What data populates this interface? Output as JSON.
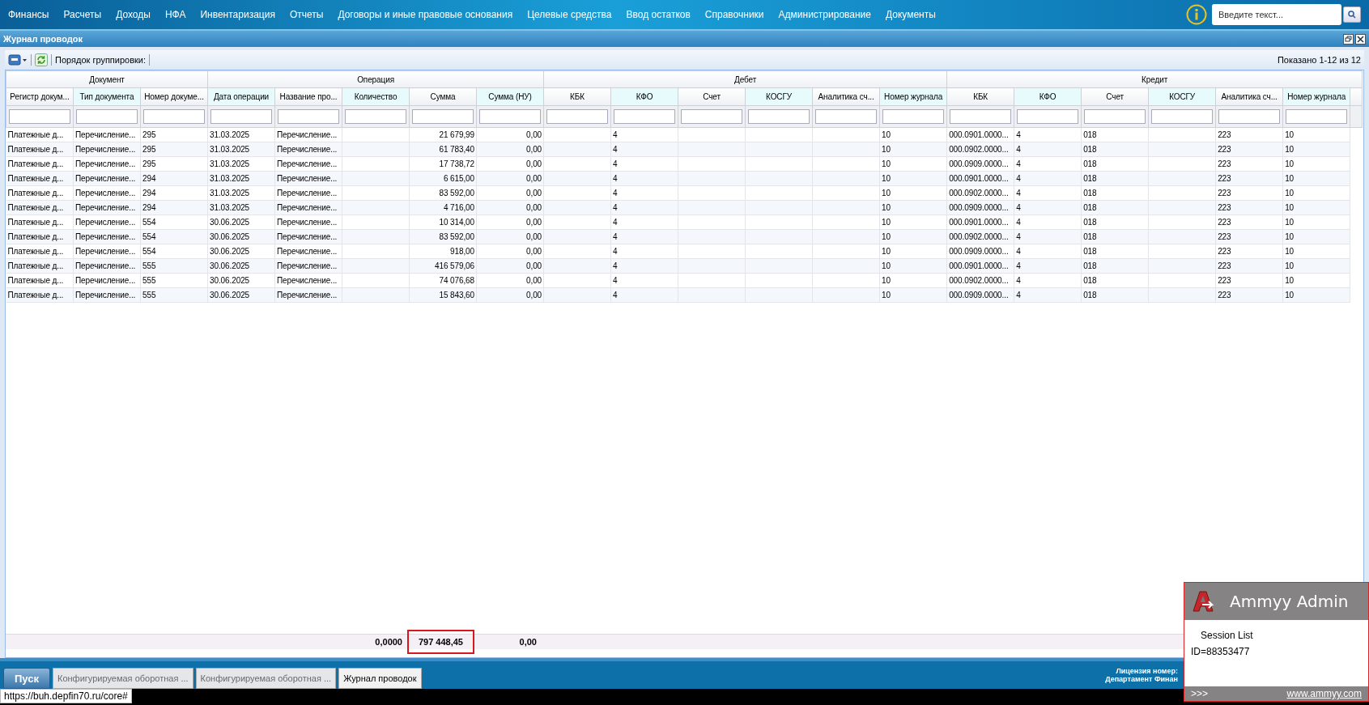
{
  "nav": {
    "items": [
      "Финансы",
      "Расчеты",
      "Доходы",
      "НФА",
      "Инвентаризация",
      "Отчеты",
      "Договоры и иные правовые основания",
      "Целевые средства",
      "Ввод остатков",
      "Справочники",
      "Администрирование",
      "Документы"
    ],
    "search": {
      "placeholder": "Введите текст..."
    }
  },
  "window": {
    "title": "Журнал проводок"
  },
  "toolbar": {
    "grouping_label": "Порядок группировки:",
    "paging": "Показано 1-12 из 12"
  },
  "table": {
    "groups": [
      {
        "title": "Документ",
        "columns": [
          {
            "title": "Регистр докум...",
            "kind": "text"
          },
          {
            "title": "Тип документа",
            "kind": "text"
          },
          {
            "title": "Номер докуме...",
            "kind": "text"
          }
        ]
      },
      {
        "title": "Операция",
        "columns": [
          {
            "title": "Дата операции",
            "kind": "text"
          },
          {
            "title": "Название про...",
            "kind": "text"
          },
          {
            "title": "Количество",
            "kind": "amount",
            "total": {
              "text": "0,0000",
              "highlighted": false
            }
          },
          {
            "title": "Сумма",
            "kind": "amount",
            "total": {
              "text": "797 448,45",
              "highlighted": true
            }
          },
          {
            "title": "Сумма (НУ)",
            "kind": "amount",
            "total": {
              "text": "0,00",
              "highlighted": false
            }
          }
        ]
      },
      {
        "title": "Дебет",
        "columns": [
          {
            "title": "КБК",
            "kind": "text"
          },
          {
            "title": "КФО",
            "kind": "text"
          },
          {
            "title": "Счет",
            "kind": "text"
          },
          {
            "title": "КОСГУ",
            "kind": "text"
          },
          {
            "title": "Аналитика сч...",
            "kind": "text"
          },
          {
            "title": "Номер журнала",
            "kind": "text"
          }
        ]
      },
      {
        "title": "Кредит",
        "columns": [
          {
            "title": "КБК",
            "kind": "text"
          },
          {
            "title": "КФО",
            "kind": "text"
          },
          {
            "title": "Счет",
            "kind": "text"
          },
          {
            "title": "КОСГУ",
            "kind": "text"
          },
          {
            "title": "Аналитика сч...",
            "kind": "text"
          },
          {
            "title": "Номер журнала",
            "kind": "text"
          }
        ]
      }
    ],
    "rows": [
      [
        "Платежные д...",
        "Перечисление...",
        "295",
        "31.03.2025",
        "Перечисление...",
        null,
        "21 679,99",
        "0,00",
        null,
        "4",
        null,
        null,
        null,
        "10",
        "000.0901.0000...",
        "4",
        "018",
        null,
        "223",
        "10"
      ],
      [
        "Платежные д...",
        "Перечисление...",
        "295",
        "31.03.2025",
        "Перечисление...",
        null,
        "61 783,40",
        "0,00",
        null,
        "4",
        null,
        null,
        null,
        "10",
        "000.0902.0000...",
        "4",
        "018",
        null,
        "223",
        "10"
      ],
      [
        "Платежные д...",
        "Перечисление...",
        "295",
        "31.03.2025",
        "Перечисление...",
        null,
        "17 738,72",
        "0,00",
        null,
        "4",
        null,
        null,
        null,
        "10",
        "000.0909.0000...",
        "4",
        "018",
        null,
        "223",
        "10"
      ],
      [
        "Платежные д...",
        "Перечисление...",
        "294",
        "31.03.2025",
        "Перечисление...",
        null,
        "6 615,00",
        "0,00",
        null,
        "4",
        null,
        null,
        null,
        "10",
        "000.0901.0000...",
        "4",
        "018",
        null,
        "223",
        "10"
      ],
      [
        "Платежные д...",
        "Перечисление...",
        "294",
        "31.03.2025",
        "Перечисление...",
        null,
        "83 592,00",
        "0,00",
        null,
        "4",
        null,
        null,
        null,
        "10",
        "000.0902.0000...",
        "4",
        "018",
        null,
        "223",
        "10"
      ],
      [
        "Платежные д...",
        "Перечисление...",
        "294",
        "31.03.2025",
        "Перечисление...",
        null,
        "4 716,00",
        "0,00",
        null,
        "4",
        null,
        null,
        null,
        "10",
        "000.0909.0000...",
        "4",
        "018",
        null,
        "223",
        "10"
      ],
      [
        "Платежные д...",
        "Перечисление...",
        "554",
        "30.06.2025",
        "Перечисление...",
        null,
        "10 314,00",
        "0,00",
        null,
        "4",
        null,
        null,
        null,
        "10",
        "000.0901.0000...",
        "4",
        "018",
        null,
        "223",
        "10"
      ],
      [
        "Платежные д...",
        "Перечисление...",
        "554",
        "30.06.2025",
        "Перечисление...",
        null,
        "83 592,00",
        "0,00",
        null,
        "4",
        null,
        null,
        null,
        "10",
        "000.0902.0000...",
        "4",
        "018",
        null,
        "223",
        "10"
      ],
      [
        "Платежные д...",
        "Перечисление...",
        "554",
        "30.06.2025",
        "Перечисление...",
        null,
        "918,00",
        "0,00",
        null,
        "4",
        null,
        null,
        null,
        "10",
        "000.0909.0000...",
        "4",
        "018",
        null,
        "223",
        "10"
      ],
      [
        "Платежные д...",
        "Перечисление...",
        "555",
        "30.06.2025",
        "Перечисление...",
        null,
        "416 579,06",
        "0,00",
        null,
        "4",
        null,
        null,
        null,
        "10",
        "000.0901.0000...",
        "4",
        "018",
        null,
        "223",
        "10"
      ],
      [
        "Платежные д...",
        "Перечисление...",
        "555",
        "30.06.2025",
        "Перечисление...",
        null,
        "74 076,68",
        "0,00",
        null,
        "4",
        null,
        null,
        null,
        "10",
        "000.0902.0000...",
        "4",
        "018",
        null,
        "223",
        "10"
      ],
      [
        "Платежные д...",
        "Перечисление...",
        "555",
        "30.06.2025",
        "Перечисление...",
        null,
        "15 843,60",
        "0,00",
        null,
        "4",
        null,
        null,
        null,
        "10",
        "000.0909.0000...",
        "4",
        "018",
        null,
        "223",
        "10"
      ]
    ]
  },
  "taskbar": {
    "start": "Пуск",
    "tabs": [
      {
        "label": "Конфигурируемая оборотная ...",
        "selected": false
      },
      {
        "label": "Конфигурируемая оборотная ...",
        "selected": false
      },
      {
        "label": "Журнал проводок",
        "selected": true
      }
    ],
    "license": [
      "Лицензия номер:",
      "Департамент Финан"
    ]
  },
  "status_url": "https://buh.depfin70.ru/core#",
  "ammyy": {
    "title": "Ammyy Admin",
    "session": "Session List",
    "id": "ID=88353477",
    "more": ">>>",
    "link": "www.ammyy.com"
  }
}
